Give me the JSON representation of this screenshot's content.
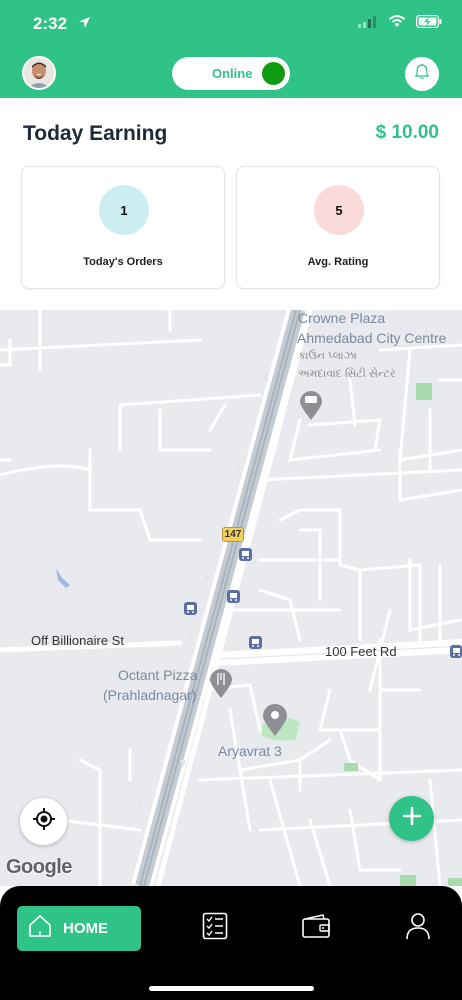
{
  "status_bar": {
    "time": "2:32",
    "icons": [
      "location-arrow-icon",
      "signal-icon",
      "wifi-icon",
      "battery-charging-icon"
    ]
  },
  "header": {
    "avatar": "avatar",
    "status_toggle": {
      "label": "Online",
      "on": true
    },
    "notification_icon": "bell-icon",
    "colors": {
      "brand": "#2fc388",
      "toggle_knob": "#0f9a0f"
    }
  },
  "earnings": {
    "title": "Today Earning",
    "amount": "$ 10.00",
    "cards": [
      {
        "value": "1",
        "label": "Today's Orders",
        "color": "#cdeef0"
      },
      {
        "value": "5",
        "label": "Avg. Rating",
        "color": "#fbdada"
      }
    ]
  },
  "map": {
    "labels": {
      "crowne_en_1": "Crowne Plaza",
      "crowne_en_2": "Ahmedabad City Centre",
      "crowne_gu_1": "કાઉન પ્લાઝા",
      "crowne_gu_2": "અમદાવાદ સિટી સેન્ટર",
      "off_billionaire": "Off Billionaire St",
      "feet_rd": "100 Feet Rd",
      "octant_1": "Octant Pizza",
      "octant_2": "(Prahladnagar)",
      "aryavrat": "Aryavrat 3",
      "route": "147"
    },
    "attribution": "Google",
    "locate_icon": "crosshair-icon",
    "add_icon": "plus-icon"
  },
  "bottom_nav": {
    "items": [
      {
        "label": "HOME",
        "icon": "home-icon",
        "active": true
      },
      {
        "label": "",
        "icon": "checklist-icon",
        "active": false
      },
      {
        "label": "",
        "icon": "wallet-icon",
        "active": false
      },
      {
        "label": "",
        "icon": "user-icon",
        "active": false
      }
    ]
  }
}
